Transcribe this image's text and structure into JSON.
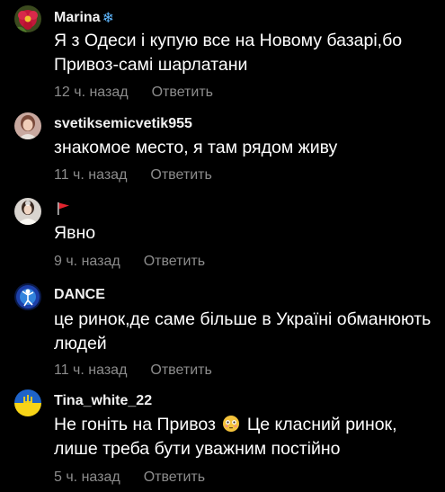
{
  "comments": [
    {
      "username": "Marina",
      "username_suffix": "❄",
      "text": "Я з Одеси і купую все на Новому базарі,бо Привоз-самі шарлатани",
      "time": "12 ч. назад",
      "reply": "Ответить",
      "avatar_icon": "flower-avatar"
    },
    {
      "username": "svetiksemicvetik955",
      "text": "знакомое место, я там рядом живу",
      "time": "11 ч. назад",
      "reply": "Ответить",
      "avatar_icon": "woman-portrait-avatar"
    },
    {
      "username": "",
      "username_icon": "red-flag-icon",
      "text": "Явно",
      "time": "9 ч. назад",
      "reply": "Ответить",
      "avatar_icon": "bride-portrait-avatar"
    },
    {
      "username": "DANCE",
      "text": "це ринок,де саме більше в Україні обманюють людей",
      "time": "11 ч. назад",
      "reply": "Ответить",
      "avatar_icon": "dancer-avatar"
    },
    {
      "username": "Tina_white_22",
      "text_before_emoji": "Не гоніть на Привоз",
      "text_emoji": "flushed-face-emoji",
      "text_after_emoji": " Це класний ринок, лише треба бути уважним постійно",
      "time": "5 ч. назад",
      "reply": "Ответить",
      "avatar_icon": "ukraine-coat-of-arms-avatar"
    }
  ],
  "colors": {
    "background": "#000000",
    "username": "#f1f1f1",
    "text": "#ffffff",
    "meta": "#8c8c8c",
    "snowflake": "#5fb8ff",
    "flag": "#e0242e"
  }
}
